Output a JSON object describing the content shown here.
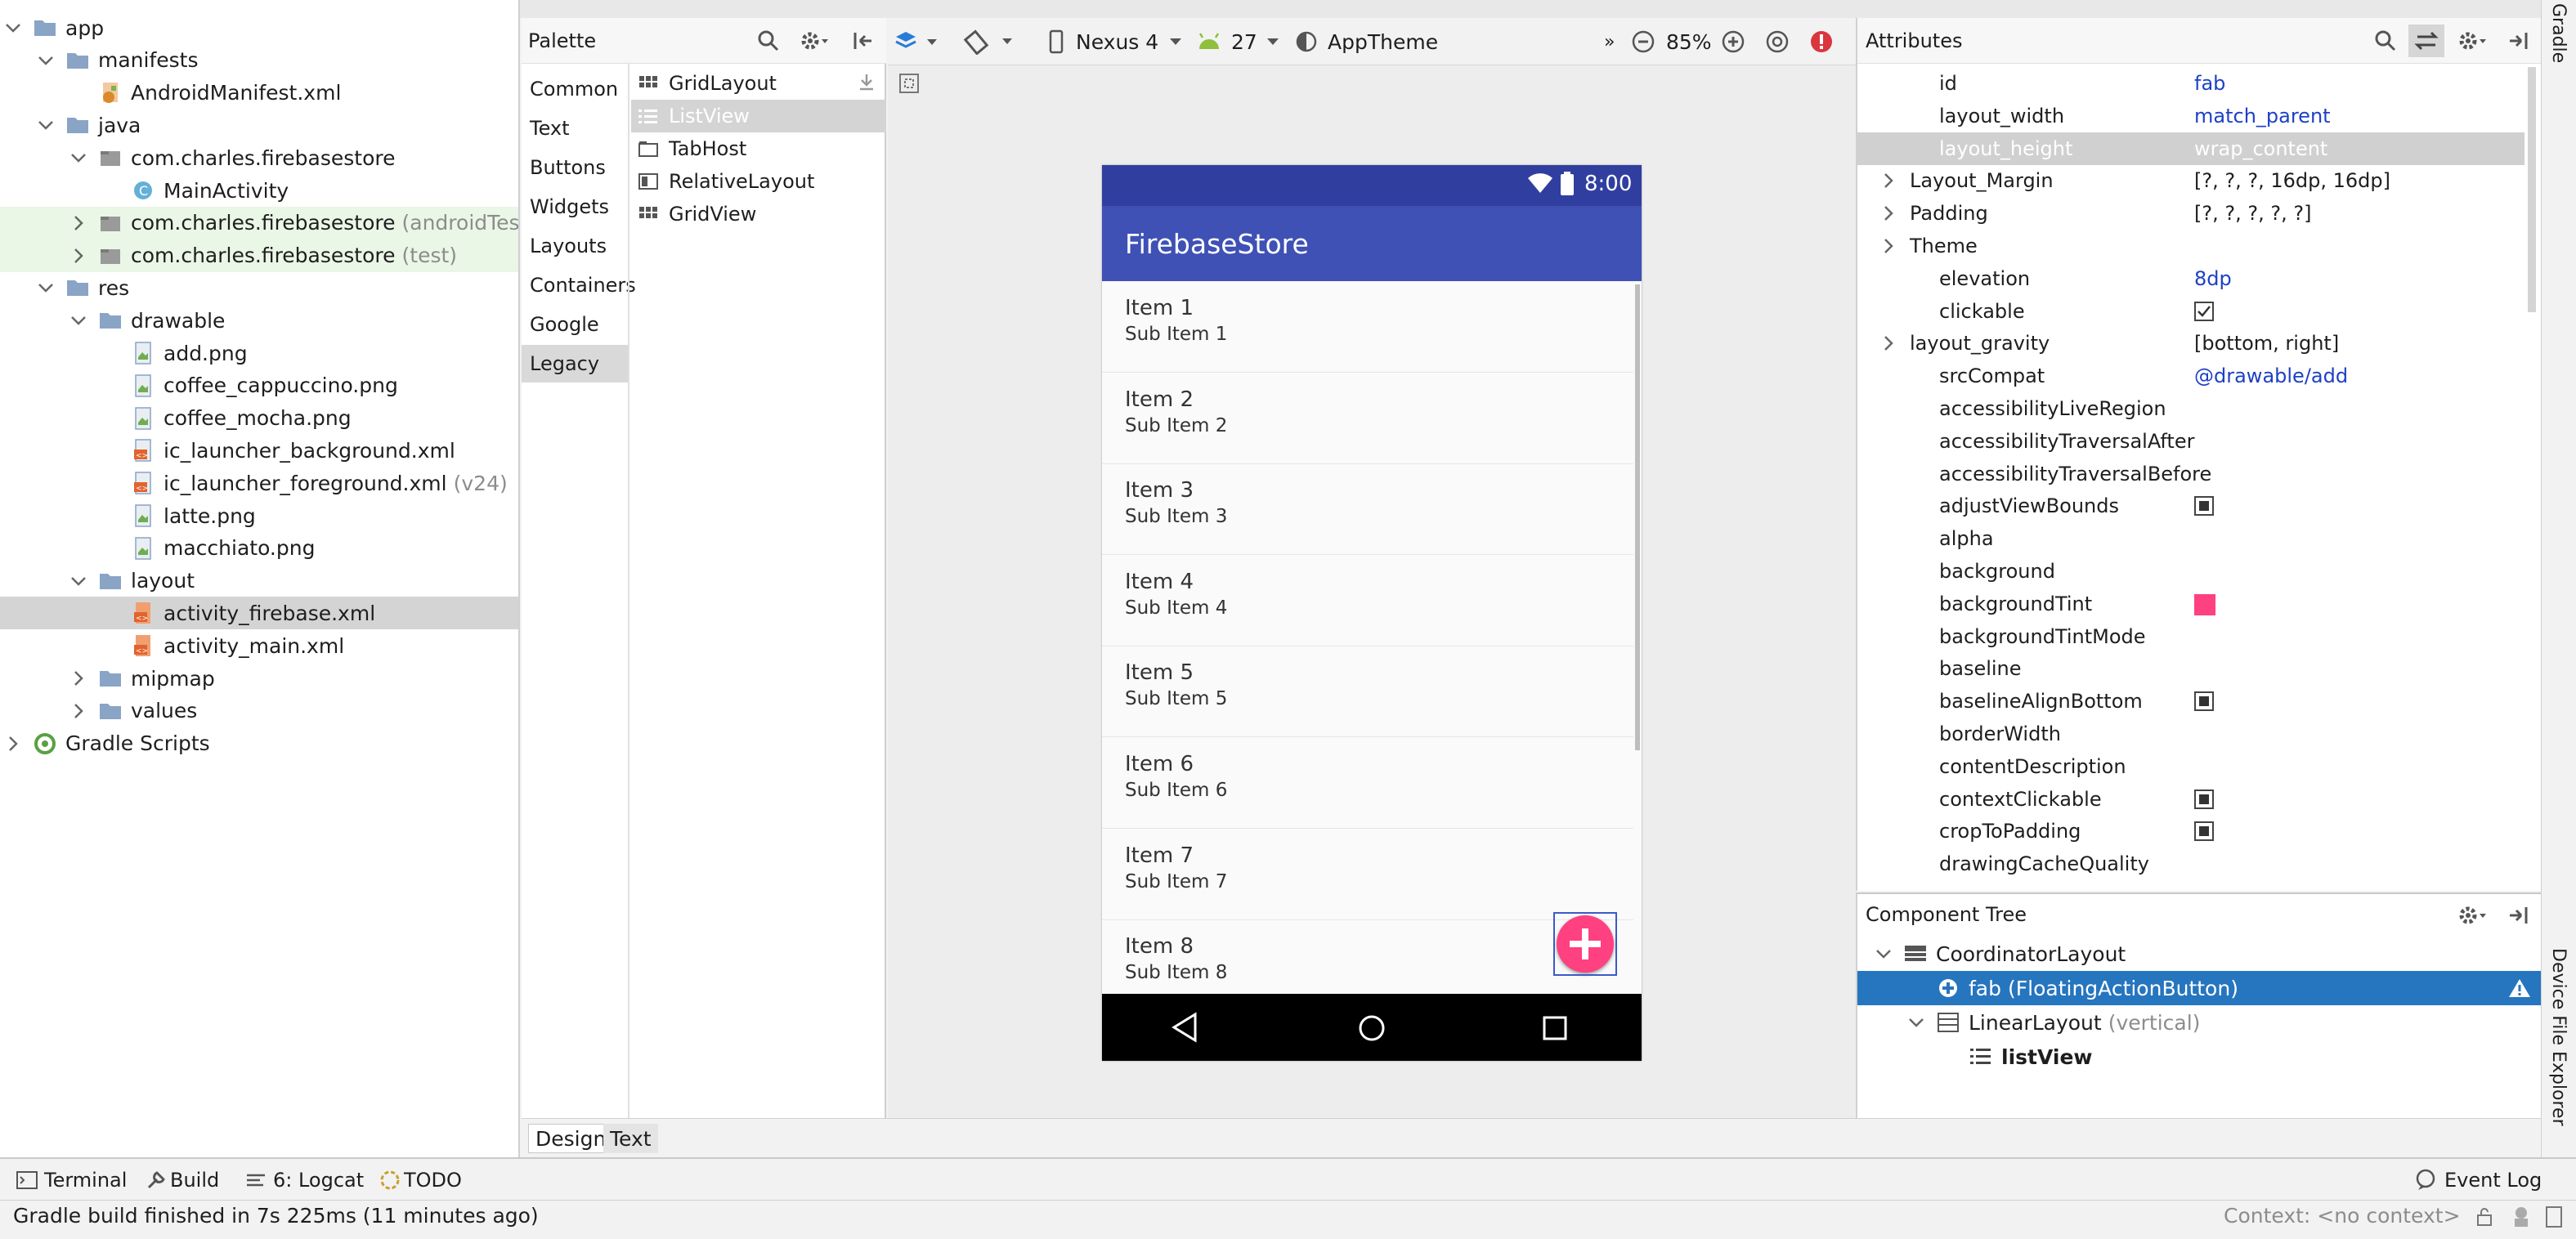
{
  "project_tree": [
    {
      "label": "app",
      "depth": 0,
      "expanded": true,
      "icon": "folder-icon"
    },
    {
      "label": "manifests",
      "depth": 1,
      "expanded": true,
      "icon": "folder-icon"
    },
    {
      "label": "AndroidManifest.xml",
      "depth": 2,
      "icon": "manifest-file-icon"
    },
    {
      "label": "java",
      "depth": 1,
      "expanded": true,
      "icon": "folder-icon"
    },
    {
      "label": "com.charles.firebasestore",
      "depth": 2,
      "expanded": true,
      "icon": "package-icon"
    },
    {
      "label": "MainActivity",
      "depth": 3,
      "icon": "class-icon"
    },
    {
      "label": "com.charles.firebasestore",
      "suffix": "(androidTest)",
      "depth": 2,
      "expanded": false,
      "icon": "package-icon",
      "highlight": "green"
    },
    {
      "label": "com.charles.firebasestore",
      "suffix": "(test)",
      "depth": 2,
      "expanded": false,
      "icon": "package-icon",
      "highlight": "green"
    },
    {
      "label": "res",
      "depth": 1,
      "expanded": true,
      "icon": "folder-icon"
    },
    {
      "label": "drawable",
      "depth": 2,
      "expanded": true,
      "icon": "folder-icon"
    },
    {
      "label": "add.png",
      "depth": 3,
      "icon": "image-file-icon"
    },
    {
      "label": "coffee_cappuccino.png",
      "depth": 3,
      "icon": "image-file-icon"
    },
    {
      "label": "coffee_mocha.png",
      "depth": 3,
      "icon": "image-file-icon"
    },
    {
      "label": "ic_launcher_background.xml",
      "depth": 3,
      "icon": "xml-file-icon"
    },
    {
      "label": "ic_launcher_foreground.xml",
      "suffix": "(v24)",
      "depth": 3,
      "icon": "xml-file-icon"
    },
    {
      "label": "latte.png",
      "depth": 3,
      "icon": "image-file-icon"
    },
    {
      "label": "macchiato.png",
      "depth": 3,
      "icon": "image-file-icon"
    },
    {
      "label": "layout",
      "depth": 2,
      "expanded": true,
      "icon": "folder-icon"
    },
    {
      "label": "activity_firebase.xml",
      "depth": 3,
      "icon": "layout-file-icon",
      "selected": true
    },
    {
      "label": "activity_main.xml",
      "depth": 3,
      "icon": "layout-file-icon"
    },
    {
      "label": "mipmap",
      "depth": 2,
      "expanded": false,
      "icon": "folder-icon"
    },
    {
      "label": "values",
      "depth": 2,
      "expanded": false,
      "icon": "folder-icon"
    },
    {
      "label": "Gradle Scripts",
      "depth": 0,
      "expanded": false,
      "icon": "gradle-icon"
    }
  ],
  "palette": {
    "title": "Palette",
    "categories": [
      "Common",
      "Text",
      "Buttons",
      "Widgets",
      "Layouts",
      "Containers",
      "Google",
      "Legacy"
    ],
    "selected_category": "Legacy",
    "items": [
      {
        "label": "GridLayout",
        "icon": "grid-icon"
      },
      {
        "label": "ListView",
        "icon": "list-icon",
        "selected": true
      },
      {
        "label": "TabHost",
        "icon": "tabhost-icon"
      },
      {
        "label": "RelativeLayout",
        "icon": "relative-layout-icon"
      },
      {
        "label": "GridView",
        "icon": "grid-icon"
      }
    ]
  },
  "design_toolbar": {
    "device": "Nexus 4",
    "api": "27",
    "theme": "AppTheme",
    "zoom": "85%",
    "overflow": "»"
  },
  "phone": {
    "time": "8:00",
    "app_title": "FirebaseStore",
    "list_items": [
      {
        "title": "Item 1",
        "sub": "Sub Item 1"
      },
      {
        "title": "Item 2",
        "sub": "Sub Item 2"
      },
      {
        "title": "Item 3",
        "sub": "Sub Item 3"
      },
      {
        "title": "Item 4",
        "sub": "Sub Item 4"
      },
      {
        "title": "Item 5",
        "sub": "Sub Item 5"
      },
      {
        "title": "Item 6",
        "sub": "Sub Item 6"
      },
      {
        "title": "Item 7",
        "sub": "Sub Item 7"
      },
      {
        "title": "Item 8",
        "sub": "Sub Item 8"
      }
    ],
    "colors": {
      "status": "#303f9f",
      "appbar": "#3f51b5",
      "fab": "#ff4081"
    }
  },
  "attributes": {
    "title": "Attributes",
    "rows": [
      {
        "key": "id",
        "value": "fab",
        "value_color": "blue"
      },
      {
        "key": "layout_width",
        "value": "match_parent",
        "value_color": "blue"
      },
      {
        "key": "layout_height",
        "value": "wrap_content",
        "selected": true
      },
      {
        "key": "Layout_Margin",
        "value": "[?, ?, ?, 16dp, 16dp]",
        "group": true
      },
      {
        "key": "Padding",
        "value": "[?, ?, ?, ?, ?]",
        "group": true
      },
      {
        "key": "Theme",
        "value": "",
        "group": true
      },
      {
        "key": "elevation",
        "value": "8dp",
        "value_color": "blue"
      },
      {
        "key": "clickable",
        "value": "",
        "checkbox": "checked"
      },
      {
        "key": "layout_gravity",
        "value": "[bottom, right]",
        "group": true
      },
      {
        "key": "srcCompat",
        "value": "@drawable/add",
        "value_color": "blue"
      },
      {
        "key": "accessibilityLiveRegion",
        "value": ""
      },
      {
        "key": "accessibilityTraversalAfter",
        "value": ""
      },
      {
        "key": "accessibilityTraversalBefore",
        "value": ""
      },
      {
        "key": "adjustViewBounds",
        "value": "",
        "checkbox": "filled"
      },
      {
        "key": "alpha",
        "value": ""
      },
      {
        "key": "background",
        "value": ""
      },
      {
        "key": "backgroundTint",
        "value": "",
        "swatch": "#ff4081"
      },
      {
        "key": "backgroundTintMode",
        "value": ""
      },
      {
        "key": "baseline",
        "value": ""
      },
      {
        "key": "baselineAlignBottom",
        "value": "",
        "checkbox": "filled"
      },
      {
        "key": "borderWidth",
        "value": ""
      },
      {
        "key": "contentDescription",
        "value": ""
      },
      {
        "key": "contextClickable",
        "value": "",
        "checkbox": "filled"
      },
      {
        "key": "cropToPadding",
        "value": "",
        "checkbox": "filled"
      },
      {
        "key": "drawingCacheQuality",
        "value": ""
      }
    ]
  },
  "component_tree": {
    "title": "Component Tree",
    "nodes": [
      {
        "label": "CoordinatorLayout",
        "suffix": "",
        "depth": 0,
        "expanded": true,
        "icon": "coordinator-icon"
      },
      {
        "label": "fab",
        "suffix": "(FloatingActionButton)",
        "depth": 1,
        "icon": "fab-icon",
        "selected": true,
        "warning": true
      },
      {
        "label": "LinearLayout",
        "suffix": "(vertical)",
        "depth": 1,
        "expanded": true,
        "icon": "linear-layout-icon"
      },
      {
        "label": "listView",
        "suffix": "",
        "depth": 2,
        "icon": "list-icon",
        "bold": true
      }
    ]
  },
  "side_tabs": {
    "gradle": "Gradle",
    "device_file_explorer": "Device File Explorer"
  },
  "design_tabs": {
    "design": "Design",
    "text": "Text"
  },
  "tool_windows": {
    "terminal": "Terminal",
    "build": "Build",
    "logcat": "6: Logcat",
    "todo": "TODO",
    "event_log": "Event Log"
  },
  "status": {
    "message": "Gradle build finished in 7s 225ms (11 minutes ago)",
    "context": "Context: <no context>"
  }
}
